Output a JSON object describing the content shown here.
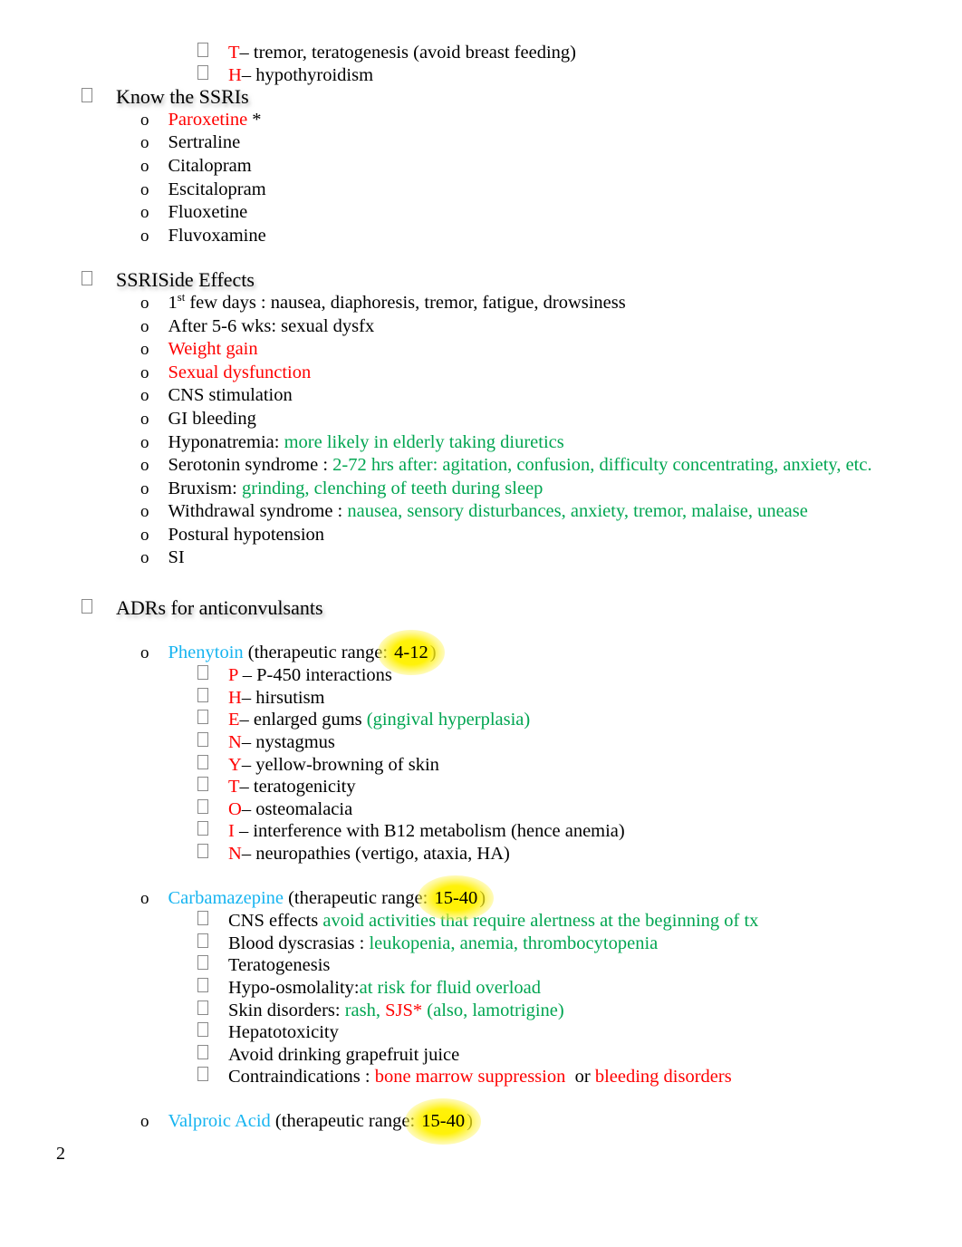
{
  "document": {
    "page_number": "2",
    "colors": {
      "red": "#FF0000",
      "green": "#00A551",
      "cyan": "#16B4F0",
      "highlight_yellow": "#FFF100",
      "body_text": "#000000"
    },
    "bullet_glyphs": {
      "level1": "missing-glyph-box",
      "level2": "o",
      "level3": "missing-glyph-box"
    }
  },
  "lithium_tail": {
    "items": [
      {
        "letter": "T",
        "dash": "– ",
        "text": "tremor, teratogenesis (avoid breast feeding)"
      },
      {
        "letter": "H",
        "dash": "– ",
        "text": "hypothyroidism"
      }
    ]
  },
  "ssri_list": {
    "heading": "Know the SSRIs",
    "items": [
      {
        "name": "Paroxetine",
        "color": "red",
        "suffix": " *"
      },
      {
        "name": "Sertraline",
        "color": "black",
        "suffix": ""
      },
      {
        "name": "Citalopram",
        "color": "black",
        "suffix": ""
      },
      {
        "name": "Escitalopram",
        "color": "black",
        "suffix": ""
      },
      {
        "name": "Fluoxetine",
        "color": "black",
        "suffix": ""
      },
      {
        "name": "Fluvoxamine",
        "color": "black",
        "suffix": ""
      }
    ]
  },
  "ssri_side_effects": {
    "heading": "SSRISide Effects",
    "items": [
      {
        "lead": "1",
        "sup": "st",
        "lead_rest": " few days : nausea, diaphoresis, tremor, fatigue, drowsiness",
        "detail": "",
        "lead_color": "black"
      },
      {
        "lead": "After 5-6 wks: sexual dysfx",
        "detail": "",
        "lead_color": "black"
      },
      {
        "lead": "Weight gain",
        "detail": "",
        "lead_color": "red"
      },
      {
        "lead": "Sexual dysfunction",
        "detail": "",
        "lead_color": "red"
      },
      {
        "lead": "CNS stimulation",
        "detail": "",
        "lead_color": "black"
      },
      {
        "lead": "GI bleeding",
        "detail": "",
        "lead_color": "black"
      },
      {
        "lead": "Hyponatremia: ",
        "detail": "more likely in elderly taking diuretics",
        "lead_color": "black"
      },
      {
        "lead": "Serotonin syndrome : ",
        "detail": "2-72 hrs after: agitation, confusion, difficulty concentrating, anxiety, etc.",
        "lead_color": "black"
      },
      {
        "lead": "Bruxism: ",
        "detail": "grinding, clenching of teeth during sleep",
        "lead_color": "black"
      },
      {
        "lead": "Withdrawal syndrome : ",
        "detail": "nausea, sensory disturbances, anxiety, tremor, malaise, unease",
        "lead_color": "black"
      },
      {
        "lead": "Postural hypotension",
        "detail": "",
        "lead_color": "black"
      },
      {
        "lead": "SI",
        "detail": "",
        "lead_color": "black"
      }
    ]
  },
  "adrs": {
    "heading": "ADRs for anticonvulsants",
    "drugs": [
      {
        "name": "Phenytoin",
        "paren_open": " (therapeutic range: ",
        "range": "4-12",
        "paren_close": ")",
        "items": [
          {
            "letter": "P",
            "dash": " – ",
            "text": "P-450 interactions",
            "detail": ""
          },
          {
            "letter": "H",
            "dash": "– ",
            "text": "hirsutism",
            "detail": ""
          },
          {
            "letter": "E",
            "dash": "– ",
            "text": "enlarged gums ",
            "detail": "(gingival hyperplasia)"
          },
          {
            "letter": "N",
            "dash": "– ",
            "text": "nystagmus",
            "detail": ""
          },
          {
            "letter": "Y",
            "dash": "– ",
            "text": "yellow-browning of skin",
            "detail": ""
          },
          {
            "letter": "T",
            "dash": "– ",
            "text": "teratogenicity",
            "detail": ""
          },
          {
            "letter": "O",
            "dash": "– ",
            "text": "osteomalacia",
            "detail": ""
          },
          {
            "letter": "I",
            "dash": " – ",
            "text": "interference with B12 metabolism (hence anemia)",
            "detail": ""
          },
          {
            "letter": "N",
            "dash": "– ",
            "text": "neuropathies (vertigo, ataxia, HA)",
            "detail": ""
          }
        ]
      },
      {
        "name": "Carbamazepine",
        "paren_open": " (therapeutic range: ",
        "range": "15-40",
        "paren_close": ")",
        "effects": [
          {
            "lead": "CNS effects ",
            "green": "avoid activities that require alertness at the beginning of tx",
            "red": "",
            "green2": ""
          },
          {
            "lead": "Blood dyscrasias : ",
            "green": "leukopenia, anemia, thrombocytopenia",
            "red": "",
            "green2": ""
          },
          {
            "lead": "Teratogenesis",
            "green": "",
            "red": "",
            "green2": ""
          },
          {
            "lead": "Hypo-osmolality:",
            "green": "at risk for fluid overload",
            "red": "",
            "green2": ""
          },
          {
            "lead": "Skin disorders: ",
            "green": "rash, ",
            "red": "SJS*",
            "green2": " (also, lamotrigine)"
          },
          {
            "lead": "Hepatotoxicity",
            "green": "",
            "red": "",
            "green2": ""
          },
          {
            "lead": "Avoid drinking grapefruit juice",
            "green": "",
            "red": "",
            "green2": ""
          },
          {
            "lead": "Contraindications : ",
            "green": "",
            "red": "bone marrow suppression",
            "mid": "  or ",
            "red2": "bleeding disorders"
          }
        ]
      },
      {
        "name": "Valproic Acid",
        "paren_open": " (therapeutic range: ",
        "range": "15-40",
        "paren_close": ")",
        "items": []
      }
    ]
  }
}
